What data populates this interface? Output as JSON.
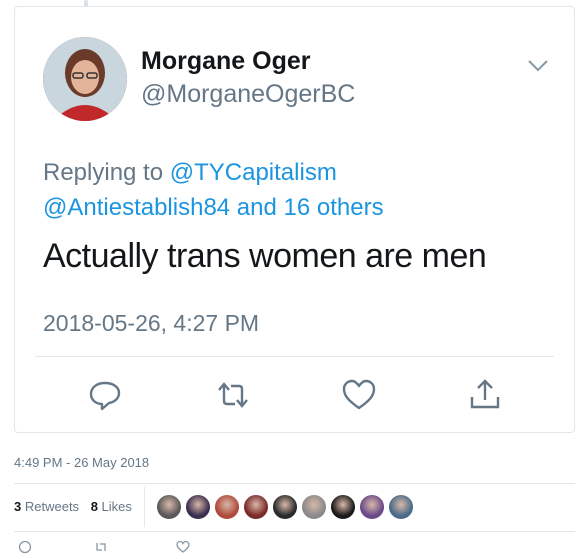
{
  "tweet": {
    "display_name": "Morgane Oger",
    "handle": "@MorganeOgerBC",
    "replying_to_prefix": "Replying to ",
    "replying_to_mention1": "@TYCapitalism",
    "replying_to_mention2": "@Antiestablish84",
    "replying_to_others": " and 16 others",
    "text": "Actually trans women are men",
    "timestamp": "2018-05-26, 4:27 PM",
    "actions": [
      {
        "icon": "reply-icon"
      },
      {
        "icon": "retweet-icon"
      },
      {
        "icon": "like-icon"
      },
      {
        "icon": "share-icon"
      }
    ]
  },
  "outer": {
    "time": "4:49 PM - 26 May 2018",
    "retweets_count": "3",
    "retweets_label": "Retweets",
    "likes_count": "8",
    "likes_label": "Likes",
    "liker_avatars": [
      "#5a5a5a",
      "#3b2f4f",
      "#b04a3a",
      "#7a2a2a",
      "#2a2a2a",
      "#8a8a8a",
      "#1a1a1a",
      "#6a4a8a",
      "#4a6a8a"
    ]
  },
  "colors": {
    "link": "#1b95e0",
    "secondary": "#657786",
    "primary": "#14171a",
    "border": "#e1e8ed"
  }
}
